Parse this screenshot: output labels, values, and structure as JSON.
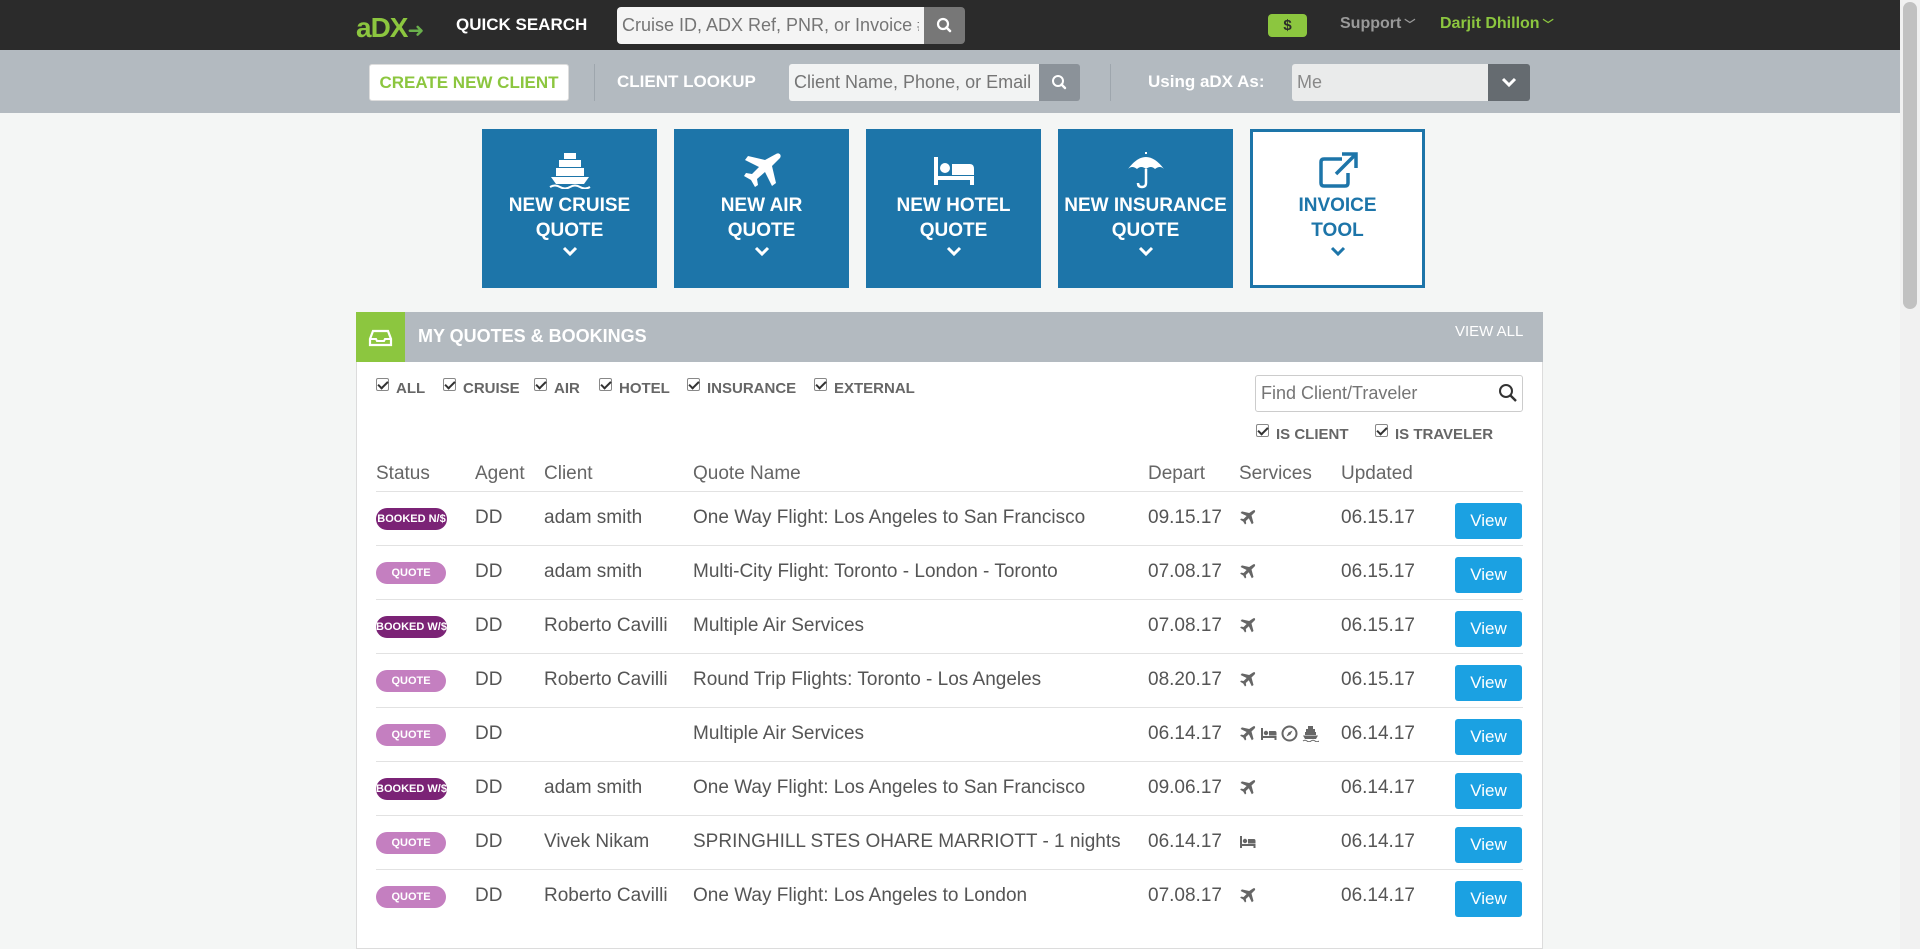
{
  "topbar": {
    "logo": {
      "a": "a",
      "dx": "DX",
      "arrow": "➜"
    },
    "quick_search_label": "QUICK SEARCH",
    "quick_search_placeholder": "Cruise ID, ADX Ref, PNR, or Invoice #.",
    "dollar": "$",
    "support": "Support",
    "user_name": "Darjit Dhillon"
  },
  "subbar": {
    "create_client": "CREATE NEW CLIENT",
    "client_lookup_label": "CLIENT LOOKUP",
    "client_lookup_placeholder": "Client Name, Phone, or Email",
    "using_as_label": "Using aDX As:",
    "using_as_value": "Me"
  },
  "tiles": [
    {
      "label": "NEW CRUISE\nQUOTE",
      "icon": "ship-icon"
    },
    {
      "label": "NEW AIR\nQUOTE",
      "icon": "plane-icon"
    },
    {
      "label": "NEW HOTEL\nQUOTE",
      "icon": "bed-icon"
    },
    {
      "label": "NEW INSURANCE\nQUOTE",
      "icon": "umbrella-icon"
    },
    {
      "label": "INVOICE\nTOOL",
      "icon": "external-link-icon"
    }
  ],
  "panel": {
    "title": "MY QUOTES & BOOKINGS",
    "view_all": "VIEW ALL",
    "filters": [
      "ALL",
      "CRUISE",
      "AIR",
      "HOTEL",
      "INSURANCE",
      "EXTERNAL"
    ],
    "find_placeholder": "Find Client/Traveler",
    "is_client": "IS CLIENT",
    "is_traveler": "IS TRAVELER",
    "columns": [
      "Status",
      "Agent",
      "Client",
      "Quote Name",
      "Depart",
      "Services",
      "Updated"
    ],
    "rows": [
      {
        "status": "BOOKED N/$",
        "type": "booked",
        "agent": "DD",
        "client": "adam smith",
        "quote": "One Way Flight: Los Angeles to San Francisco",
        "depart": "09.15.17",
        "services": [
          "plane"
        ],
        "updated": "06.15.17",
        "action": "View"
      },
      {
        "status": "QUOTE",
        "type": "quote",
        "agent": "DD",
        "client": "adam smith",
        "quote": "Multi-City Flight: Toronto - London - Toronto",
        "depart": "07.08.17",
        "services": [
          "plane"
        ],
        "updated": "06.15.17",
        "action": "View"
      },
      {
        "status": "BOOKED W/$",
        "type": "booked",
        "agent": "DD",
        "client": "Roberto Cavilli",
        "quote": "Multiple Air Services",
        "depart": "07.08.17",
        "services": [
          "plane"
        ],
        "updated": "06.15.17",
        "action": "View"
      },
      {
        "status": "QUOTE",
        "type": "quote",
        "agent": "DD",
        "client": "Roberto Cavilli",
        "quote": "Round Trip Flights: Toronto - Los Angeles",
        "depart": "08.20.17",
        "services": [
          "plane"
        ],
        "updated": "06.15.17",
        "action": "View"
      },
      {
        "status": "QUOTE",
        "type": "quote",
        "agent": "DD",
        "client": "",
        "quote": "Multiple Air Services",
        "depart": "06.14.17",
        "services": [
          "plane",
          "bed",
          "compass",
          "ship"
        ],
        "updated": "06.14.17",
        "action": "View"
      },
      {
        "status": "BOOKED W/$",
        "type": "booked",
        "agent": "DD",
        "client": "adam smith",
        "quote": "One Way Flight: Los Angeles to San Francisco",
        "depart": "09.06.17",
        "services": [
          "plane"
        ],
        "updated": "06.14.17",
        "action": "View"
      },
      {
        "status": "QUOTE",
        "type": "quote",
        "agent": "DD",
        "client": "Vivek Nikam",
        "quote": "SPRINGHILL STES OHARE MARRIOTT - 1 nights",
        "depart": "06.14.17",
        "services": [
          "bed"
        ],
        "updated": "06.14.17",
        "action": "View"
      },
      {
        "status": "QUOTE",
        "type": "quote",
        "agent": "DD",
        "client": "Roberto Cavilli",
        "quote": "One Way Flight: Los Angeles to London",
        "depart": "07.08.17",
        "services": [
          "plane"
        ],
        "updated": "06.14.17",
        "action": "View"
      }
    ]
  },
  "colors": {
    "accent_green": "#8cc63f",
    "tile_blue": "#1d75a9",
    "view_blue": "#1ba1e2",
    "booked": "#7b2376",
    "quote": "#c47fc0"
  }
}
